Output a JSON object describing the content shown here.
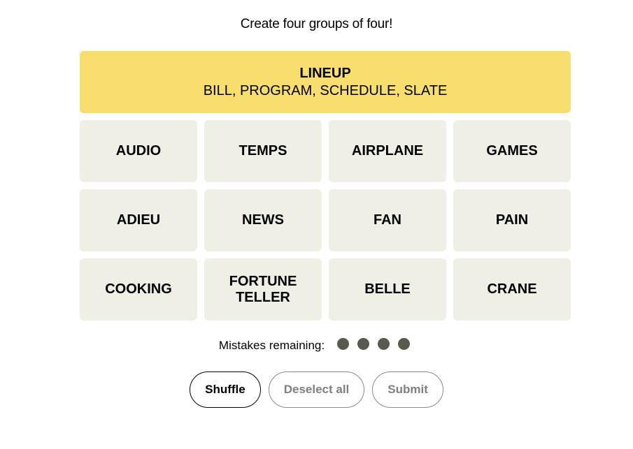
{
  "instructions": "Create four groups of four!",
  "solved_groups": [
    {
      "title": "LINEUP",
      "members": "BILL, PROGRAM, SCHEDULE, SLATE",
      "color": "#f7de6d"
    }
  ],
  "tiles": [
    "AUDIO",
    "TEMPS",
    "AIRPLANE",
    "GAMES",
    "ADIEU",
    "NEWS",
    "FAN",
    "PAIN",
    "COOKING",
    "FORTUNE\nTELLER",
    "BELLE",
    "CRANE"
  ],
  "mistakes": {
    "label": "Mistakes remaining:",
    "remaining": 4,
    "dot_color": "#5a594e"
  },
  "controls": {
    "shuffle_label": "Shuffle",
    "deselect_label": "Deselect all",
    "submit_label": "Submit"
  }
}
